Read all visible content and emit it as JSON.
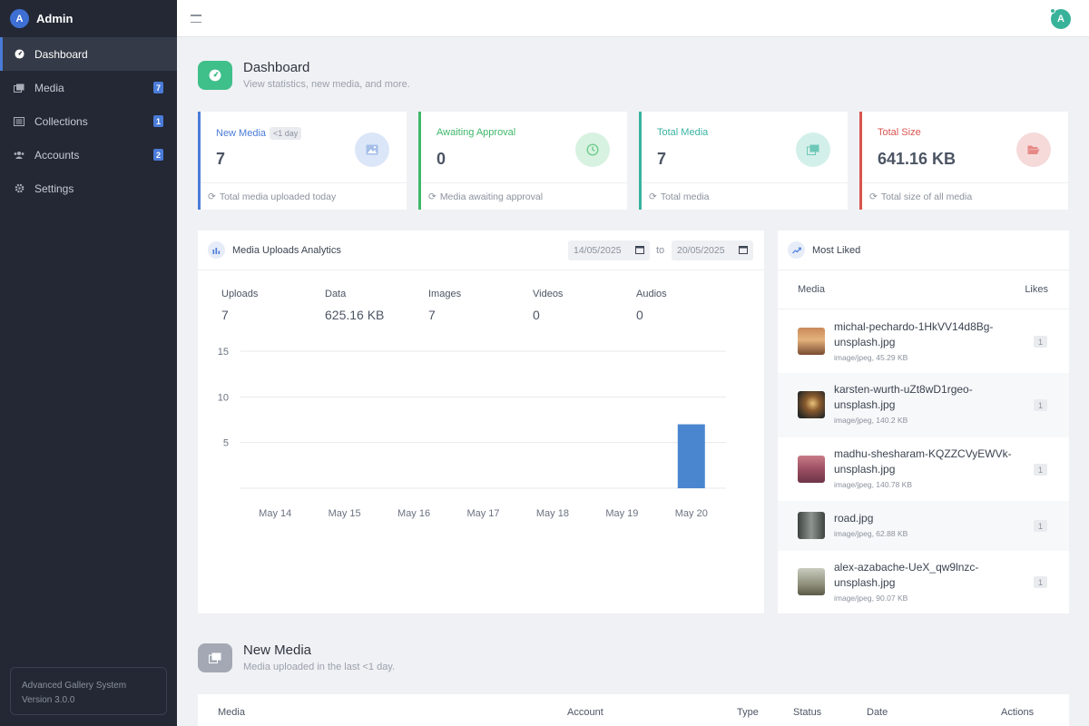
{
  "sidebar": {
    "brand_initial": "A",
    "brand_name": "Admin",
    "items": [
      {
        "label": "Dashboard",
        "badge": "",
        "icon": "dashboard-icon",
        "active": true
      },
      {
        "label": "Media",
        "badge": "7",
        "icon": "images-icon"
      },
      {
        "label": "Collections",
        "badge": "1",
        "icon": "list-icon"
      },
      {
        "label": "Accounts",
        "badge": "2",
        "icon": "users-icon"
      },
      {
        "label": "Settings",
        "badge": "",
        "icon": "gear-icon"
      }
    ],
    "app_name": "Advanced Gallery System",
    "version": "Version 3.0.0"
  },
  "topbar": {
    "avatar_initial": "A"
  },
  "dashboard_header": {
    "title": "Dashboard",
    "subtitle": "View statistics, new media, and more."
  },
  "stats": [
    {
      "label": "New Media",
      "badge": "<1 day",
      "value": "7",
      "footer": "Total media uploaded today",
      "color": "#4a7bd8"
    },
    {
      "label": "Awaiting Approval",
      "badge": "",
      "value": "0",
      "footer": "Media awaiting approval",
      "color": "#3fb76a"
    },
    {
      "label": "Total Media",
      "badge": "",
      "value": "7",
      "footer": "Total media",
      "color": "#38b3a0"
    },
    {
      "label": "Total Size",
      "badge": "",
      "value": "641.16 KB",
      "footer": "Total size of all media",
      "color": "#d9534f"
    }
  ],
  "analytics": {
    "title": "Media Uploads Analytics",
    "date_from": "14/05/2025",
    "date_to": "20/05/2025",
    "to_label": "to",
    "metrics": [
      {
        "label": "Uploads",
        "value": "7"
      },
      {
        "label": "Data",
        "value": "625.16 KB"
      },
      {
        "label": "Images",
        "value": "7"
      },
      {
        "label": "Videos",
        "value": "0"
      },
      {
        "label": "Audios",
        "value": "0"
      }
    ]
  },
  "chart_data": {
    "type": "bar",
    "categories": [
      "May 14",
      "May 15",
      "May 16",
      "May 17",
      "May 18",
      "May 19",
      "May 20"
    ],
    "values": [
      0,
      0,
      0,
      0,
      0,
      0,
      7
    ],
    "ylim": [
      0,
      15
    ],
    "yticks": [
      5,
      10,
      15
    ],
    "grid": true,
    "bar_color": "#4a86d0"
  },
  "most_liked": {
    "title": "Most Liked",
    "col_media": "Media",
    "col_likes": "Likes",
    "items": [
      {
        "name": "michal-pechardo-1HkVV14d8Bg-unsplash.jpg",
        "meta": "image/jpeg, 45.29 KB",
        "likes": "1"
      },
      {
        "name": "karsten-wurth-uZt8wD1rgeo-unsplash.jpg",
        "meta": "image/jpeg, 140.2 KB",
        "likes": "1"
      },
      {
        "name": "madhu-shesharam-KQZZCVyEWVk-unsplash.jpg",
        "meta": "image/jpeg, 140.78 KB",
        "likes": "1"
      },
      {
        "name": "road.jpg",
        "meta": "image/jpeg, 62.88 KB",
        "likes": "1"
      },
      {
        "name": "alex-azabache-UeX_qw9lnzc-unsplash.jpg",
        "meta": "image/jpeg, 90.07 KB",
        "likes": "1"
      }
    ]
  },
  "new_media": {
    "title": "New Media",
    "subtitle": "Media uploaded in the last <1 day.",
    "columns": [
      "Media",
      "Account",
      "Type",
      "Status",
      "Date",
      "Actions"
    ]
  }
}
